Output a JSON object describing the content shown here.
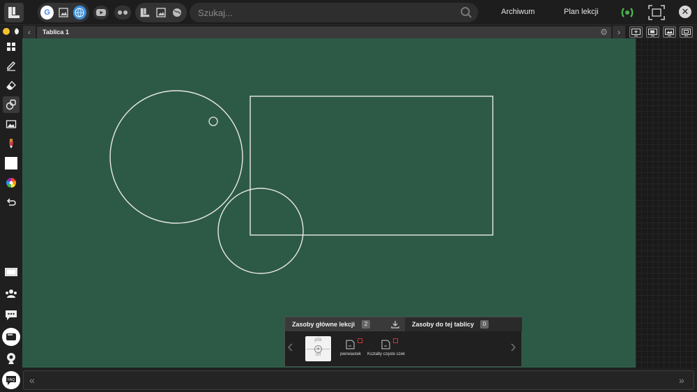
{
  "topbar": {
    "search_placeholder": "Szukaj...",
    "archive_label": "Archiwum",
    "lesson_plan_label": "Plan lekcji"
  },
  "tabbar": {
    "tab_title": "Tablica 1"
  },
  "resources": {
    "main_tab_label": "Zasoby główne lekcji",
    "main_count": "2",
    "board_tab_label": "Zasoby do tej tablicy",
    "board_count": "0",
    "add_top": "plik",
    "add_bottom": "url",
    "items": [
      {
        "label": "pierwiastek"
      },
      {
        "label": "Kształty częste czek"
      }
    ]
  },
  "colors": {
    "board": "#2d5a47",
    "chalk": "#e8e8e8",
    "accent_live": "#4caf50"
  }
}
